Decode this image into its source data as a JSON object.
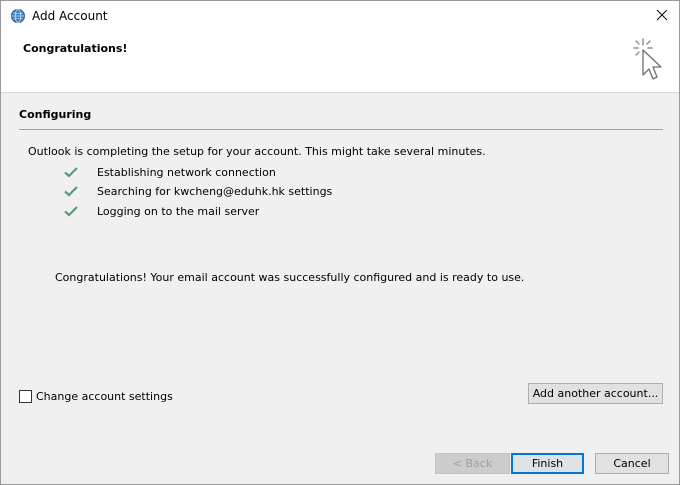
{
  "window": {
    "title": "Add Account",
    "close_glyph": "✕"
  },
  "header": {
    "title": "Congratulations!",
    "icon": "click-cursor-icon"
  },
  "section": {
    "title": "Configuring",
    "intro": "Outlook is completing the setup for your account. This might take several minutes.",
    "steps": [
      {
        "label": "Establishing network connection",
        "status": "done"
      },
      {
        "label": "Searching for kwcheng@eduhk.hk settings",
        "status": "done"
      },
      {
        "label": "Logging on to the mail server",
        "status": "done"
      }
    ],
    "success_message": "Congratulations! Your email account was successfully configured and is ready to use."
  },
  "options": {
    "change_settings_label": "Change account settings",
    "change_settings_checked": false,
    "add_another_label": "Add another account..."
  },
  "footer": {
    "back_label": "< Back",
    "finish_label": "Finish",
    "cancel_label": "Cancel"
  },
  "colors": {
    "check": "#5b9a78",
    "focus_border": "#0078d7",
    "dialog_bg": "#f0f0f0"
  }
}
